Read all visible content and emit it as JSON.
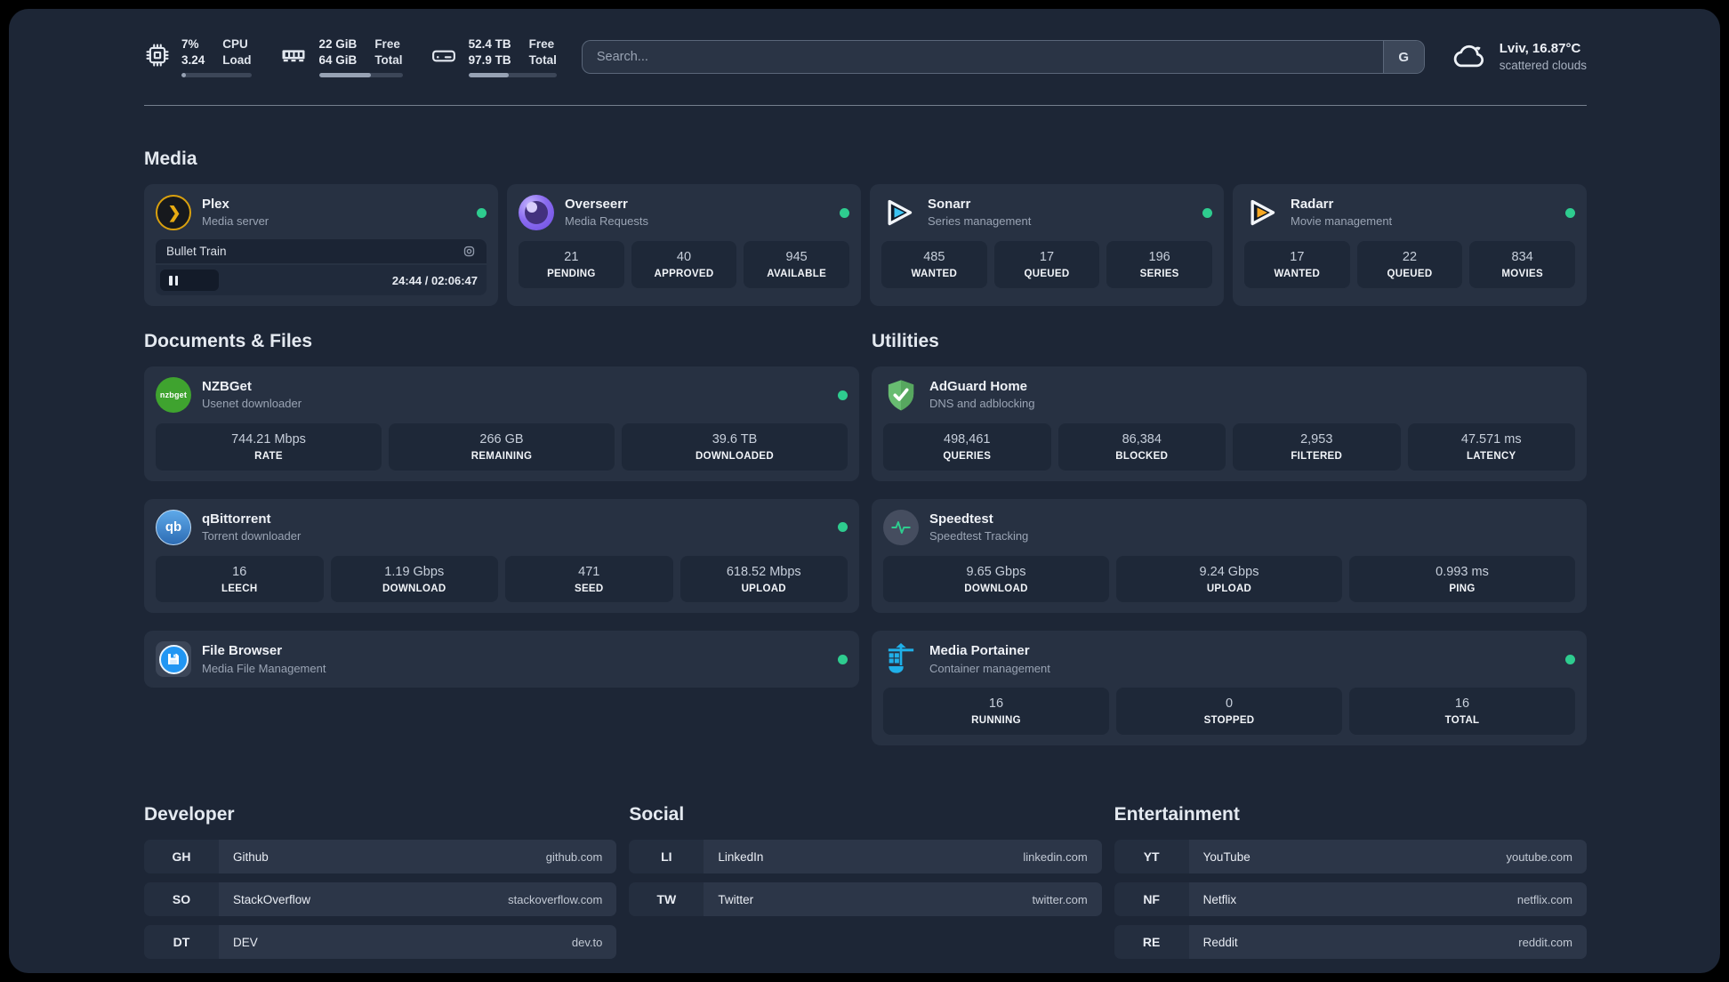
{
  "system": {
    "cpu": {
      "value_top": "7%",
      "value_bottom": "3.24",
      "label_top": "CPU",
      "label_bottom": "Load",
      "bar_style": "width:7%"
    },
    "memory": {
      "value_top": "22 GiB",
      "value_bottom": "64 GiB",
      "label_top": "Free",
      "label_bottom": "Total",
      "bar_style": "width:62%"
    },
    "storage": {
      "value_top": "52.4 TB",
      "value_bottom": "97.9 TB",
      "label_top": "Free",
      "label_bottom": "Total",
      "bar_style": "width:46%"
    }
  },
  "search": {
    "placeholder": "Search...",
    "provider_label": "G"
  },
  "weather": {
    "location": "Lviv, 16.87°C",
    "condition": "scattered clouds"
  },
  "icons": {
    "plex_glyph": "❯",
    "nzbget_glyph": "nzbget",
    "qbittorrent_glyph": "qb"
  },
  "colors": {
    "status_online": "#2ecc8f",
    "plex_amber": "#e8ab12",
    "sonarr_blue": "#3cc3f2",
    "radarr_amber": "#f7a823",
    "nzbget_green": "#3fa32f",
    "qbittorrent_blue": "#2d6cb4",
    "adguard_green": "#63b663",
    "speedtest_green": "#2ecc8f",
    "portainer_blue": "#1fb0e9",
    "filebrowser_blue": "#2196f3"
  },
  "media": {
    "title": "Media",
    "plex": {
      "name": "Plex",
      "desc": "Media server",
      "now_playing": "Bullet Train",
      "time": "24:44 / 02:06:47"
    },
    "overseerr": {
      "name": "Overseerr",
      "desc": "Media Requests",
      "stats": [
        {
          "value": "21",
          "label": "PENDING"
        },
        {
          "value": "40",
          "label": "APPROVED"
        },
        {
          "value": "945",
          "label": "AVAILABLE"
        }
      ]
    },
    "sonarr": {
      "name": "Sonarr",
      "desc": "Series management",
      "stats": [
        {
          "value": "485",
          "label": "WANTED"
        },
        {
          "value": "17",
          "label": "QUEUED"
        },
        {
          "value": "196",
          "label": "SERIES"
        }
      ]
    },
    "radarr": {
      "name": "Radarr",
      "desc": "Movie management",
      "stats": [
        {
          "value": "17",
          "label": "WANTED"
        },
        {
          "value": "22",
          "label": "QUEUED"
        },
        {
          "value": "834",
          "label": "MOVIES"
        }
      ]
    }
  },
  "documents": {
    "title": "Documents & Files",
    "nzbget": {
      "name": "NZBGet",
      "desc": "Usenet downloader",
      "stats": [
        {
          "value": "744.21 Mbps",
          "label": "RATE"
        },
        {
          "value": "266 GB",
          "label": "REMAINING"
        },
        {
          "value": "39.6 TB",
          "label": "DOWNLOADED"
        }
      ]
    },
    "qbittorrent": {
      "name": "qBittorrent",
      "desc": "Torrent downloader",
      "stats": [
        {
          "value": "16",
          "label": "LEECH"
        },
        {
          "value": "1.19 Gbps",
          "label": "DOWNLOAD"
        },
        {
          "value": "471",
          "label": "SEED"
        },
        {
          "value": "618.52 Mbps",
          "label": "UPLOAD"
        }
      ]
    },
    "filebrowser": {
      "name": "File Browser",
      "desc": "Media File Management"
    }
  },
  "utilities": {
    "title": "Utilities",
    "adguard": {
      "name": "AdGuard Home",
      "desc": "DNS and adblocking",
      "stats": [
        {
          "value": "498,461",
          "label": "QUERIES"
        },
        {
          "value": "86,384",
          "label": "BLOCKED"
        },
        {
          "value": "2,953",
          "label": "FILTERED"
        },
        {
          "value": "47.571 ms",
          "label": "LATENCY"
        }
      ]
    },
    "speedtest": {
      "name": "Speedtest",
      "desc": "Speedtest Tracking",
      "stats": [
        {
          "value": "9.65 Gbps",
          "label": "DOWNLOAD"
        },
        {
          "value": "9.24 Gbps",
          "label": "UPLOAD"
        },
        {
          "value": "0.993 ms",
          "label": "PING"
        }
      ]
    },
    "portainer": {
      "name": "Media Portainer",
      "desc": "Container management",
      "stats": [
        {
          "value": "16",
          "label": "RUNNING"
        },
        {
          "value": "0",
          "label": "STOPPED"
        },
        {
          "value": "16",
          "label": "TOTAL"
        }
      ]
    }
  },
  "bookmarks": {
    "developer": {
      "title": "Developer",
      "links": [
        {
          "abbr": "GH",
          "name": "Github",
          "url": "github.com"
        },
        {
          "abbr": "SO",
          "name": "StackOverflow",
          "url": "stackoverflow.com"
        },
        {
          "abbr": "DT",
          "name": "DEV",
          "url": "dev.to"
        }
      ]
    },
    "social": {
      "title": "Social",
      "links": [
        {
          "abbr": "LI",
          "name": "LinkedIn",
          "url": "linkedin.com"
        },
        {
          "abbr": "TW",
          "name": "Twitter",
          "url": "twitter.com"
        }
      ]
    },
    "entertainment": {
      "title": "Entertainment",
      "links": [
        {
          "abbr": "YT",
          "name": "YouTube",
          "url": "youtube.com"
        },
        {
          "abbr": "NF",
          "name": "Netflix",
          "url": "netflix.com"
        },
        {
          "abbr": "RE",
          "name": "Reddit",
          "url": "reddit.com"
        }
      ]
    }
  }
}
